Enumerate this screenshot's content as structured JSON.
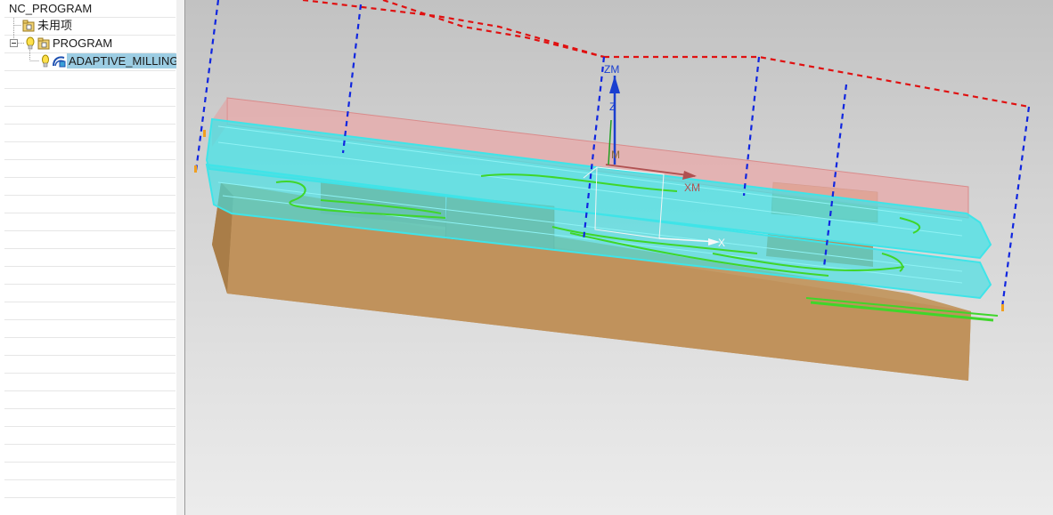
{
  "navigator": {
    "title": "NC_PROGRAM",
    "nodes": [
      {
        "label": "未用项"
      },
      {
        "label": "PROGRAM"
      },
      {
        "label": "ADAPTIVE_MILLING"
      }
    ]
  },
  "viewport": {
    "axes": {
      "zm": "ZM",
      "xm": "XM",
      "m": "M",
      "z": "Z",
      "x": "X"
    }
  },
  "colors": {
    "stock_tan": "#c0925c",
    "blank_pink": "#e8a8a8",
    "toolpath_cyan": "#3fe4e8",
    "toolpath_green": "#3fd62a",
    "rapid_red": "#e01010",
    "rapid_blue": "#1026e0",
    "selection": "#9ccde3"
  },
  "icons": [
    "expand-collapse-icon",
    "folder-icon",
    "bulb-icon",
    "operation-icon"
  ]
}
